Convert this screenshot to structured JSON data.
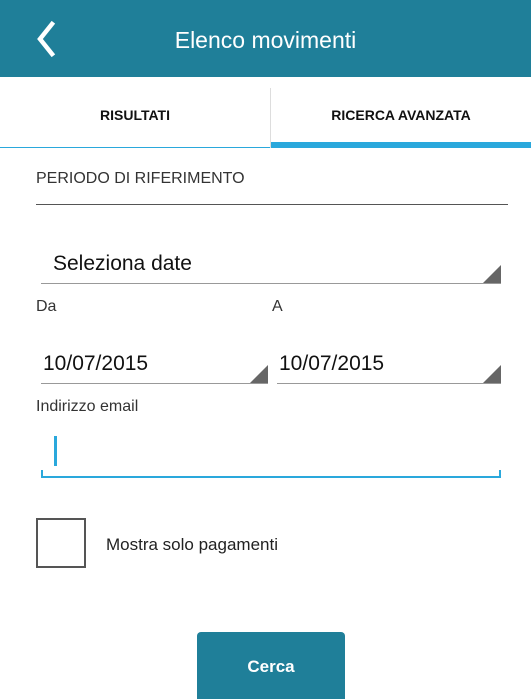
{
  "appbar": {
    "title": "Elenco movimenti",
    "back_icon": "chevron-left-icon",
    "background": "#1f7f99"
  },
  "tabs": [
    {
      "label": "RISULTATI",
      "selected": false
    },
    {
      "label": "RICERCA AVANZATA",
      "selected": true
    }
  ],
  "accent": "#2aa8dc",
  "form": {
    "section_title": "PERIODO DI RIFERIMENTO",
    "date_range_select": "Seleziona date",
    "from_label": "Da",
    "to_label": "A",
    "from_value": "10/07/2015",
    "to_value": "10/07/2015",
    "email_label": "Indirizzo email",
    "email_value": "",
    "checkbox_label": "Mostra solo pagamenti",
    "checkbox_checked": false,
    "search_button": "Cerca"
  }
}
